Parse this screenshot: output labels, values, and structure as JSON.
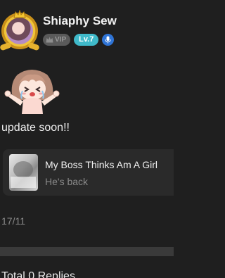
{
  "user": {
    "name": "Shiaphy Sew",
    "vip_label": "VIP",
    "level_label": "Lv.7"
  },
  "post": {
    "text": "update soon!!",
    "date": "17/11"
  },
  "linked_item": {
    "title": "My Boss Thinks Am A Girl",
    "subtitle": "He's back"
  },
  "replies": {
    "header": "Total 0 Replies"
  },
  "colors": {
    "background": "#1f1f1f",
    "level_badge": "#3fb9c9",
    "mic_badge": "#2f74d6",
    "vip_badge": "#5a5a5a",
    "avatar_frame_gold": "#f0c53a"
  },
  "icons": {
    "avatar_frame": "gold-crown-frame-icon",
    "vip": "crown-icon",
    "mic": "microphone-icon",
    "sticker": "crying-chibi-girl-sticker"
  }
}
